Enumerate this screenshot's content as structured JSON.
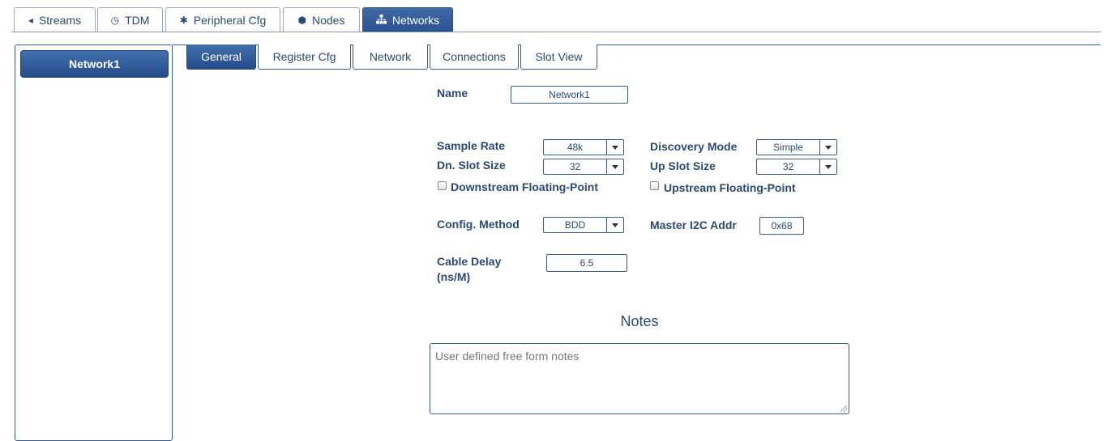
{
  "top_tabs": [
    {
      "label": "Streams",
      "icon": "speaker-icon"
    },
    {
      "label": "TDM",
      "icon": "clock-icon"
    },
    {
      "label": "Peripheral Cfg",
      "icon": "gear-icon"
    },
    {
      "label": "Nodes",
      "icon": "cube-icon"
    },
    {
      "label": "Networks",
      "icon": "sitemap-icon",
      "active": true
    }
  ],
  "sidebar": {
    "network_button": "Network1"
  },
  "sub_tabs": [
    {
      "label": "General",
      "active": true
    },
    {
      "label": "Register Cfg"
    },
    {
      "label": "Network"
    },
    {
      "label": "Connections"
    },
    {
      "label": "Slot View"
    }
  ],
  "form": {
    "name_label": "Name",
    "name_value": "Network1",
    "sample_rate_label": "Sample Rate",
    "sample_rate_value": "48k",
    "dn_slot_label": "Dn. Slot Size",
    "dn_slot_value": "32",
    "downstream_fp_label": "Downstream Floating-Point",
    "discovery_label": "Discovery Mode",
    "discovery_value": "Simple",
    "up_slot_label": "Up Slot Size",
    "up_slot_value": "32",
    "upstream_fp_label": "Upstream Floating-Point",
    "config_method_label": "Config. Method",
    "config_method_value": "BDD",
    "master_i2c_label": "Master I2C Addr",
    "master_i2c_value": "0x68",
    "cable_delay_label_1": "Cable Delay",
    "cable_delay_label_2": "(ns/M)",
    "cable_delay_value": "6.5"
  },
  "notes": {
    "title": "Notes",
    "placeholder": "User defined free form notes"
  }
}
